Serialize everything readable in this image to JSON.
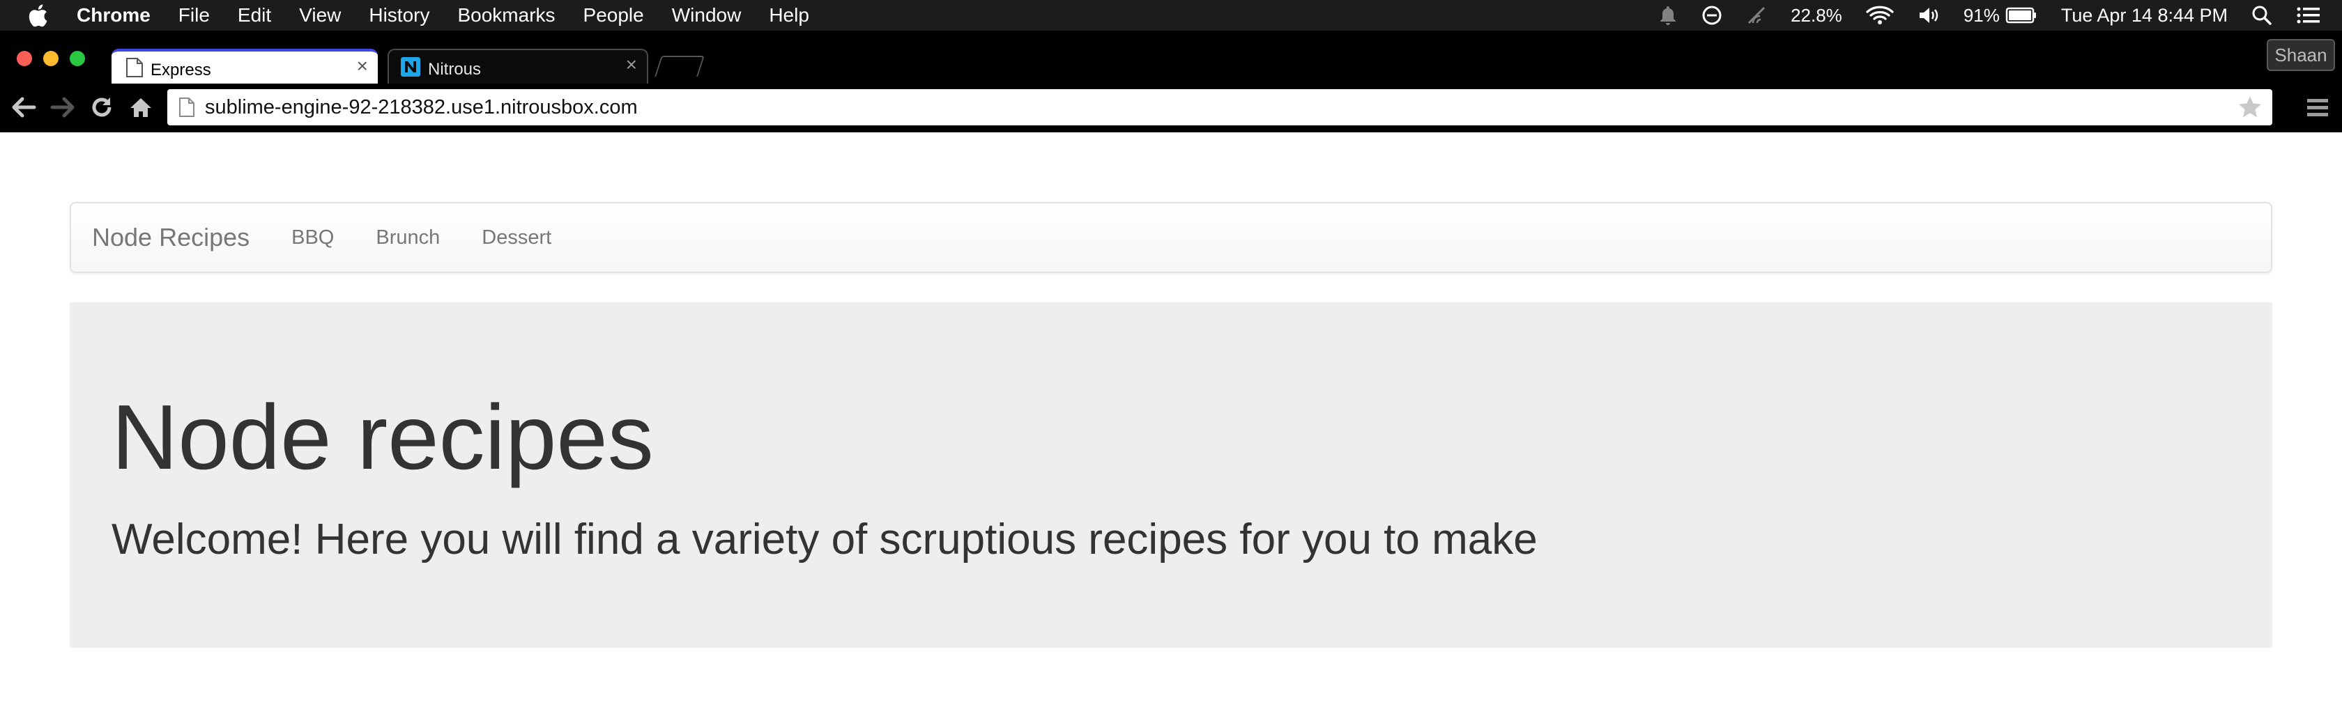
{
  "menubar": {
    "app_name": "Chrome",
    "items": [
      "File",
      "Edit",
      "View",
      "History",
      "Bookmarks",
      "People",
      "Window",
      "Help"
    ],
    "status": {
      "cpu": "22.8%",
      "battery": "91%",
      "clock": "Tue Apr 14  8:44 PM"
    }
  },
  "browser": {
    "tabs": [
      {
        "title": "Express"
      },
      {
        "title": "Nitrous"
      }
    ],
    "profile": "Shaan",
    "url": "sublime-engine-92-218382.use1.nitrousbox.com"
  },
  "page": {
    "navbar": {
      "brand": "Node Recipes",
      "links": [
        "BBQ",
        "Brunch",
        "Dessert"
      ]
    },
    "jumbotron": {
      "heading": "Node recipes",
      "lead": "Welcome! Here you will find a variety of scruptious recipes for you to make"
    }
  },
  "colors": {
    "menubar_bg": "#1c1c1e",
    "active_tab_accent": "#3f48e6",
    "nitrous_favicon": "#1ea7e8",
    "jumbotron_bg": "#eeeeee",
    "nav_text": "#777777",
    "heading_text": "#333333"
  },
  "icons": {
    "menubar": [
      "apple-icon",
      "notification-bell-icon",
      "sync-icon",
      "signal-icon",
      "wifi-icon",
      "volume-icon",
      "battery-icon",
      "spotlight-search-icon",
      "notification-center-icon"
    ],
    "toolbar": [
      "back-arrow-icon",
      "forward-arrow-icon",
      "reload-icon",
      "home-icon",
      "page-icon",
      "bookmark-star-icon",
      "chrome-menu-icon"
    ]
  }
}
